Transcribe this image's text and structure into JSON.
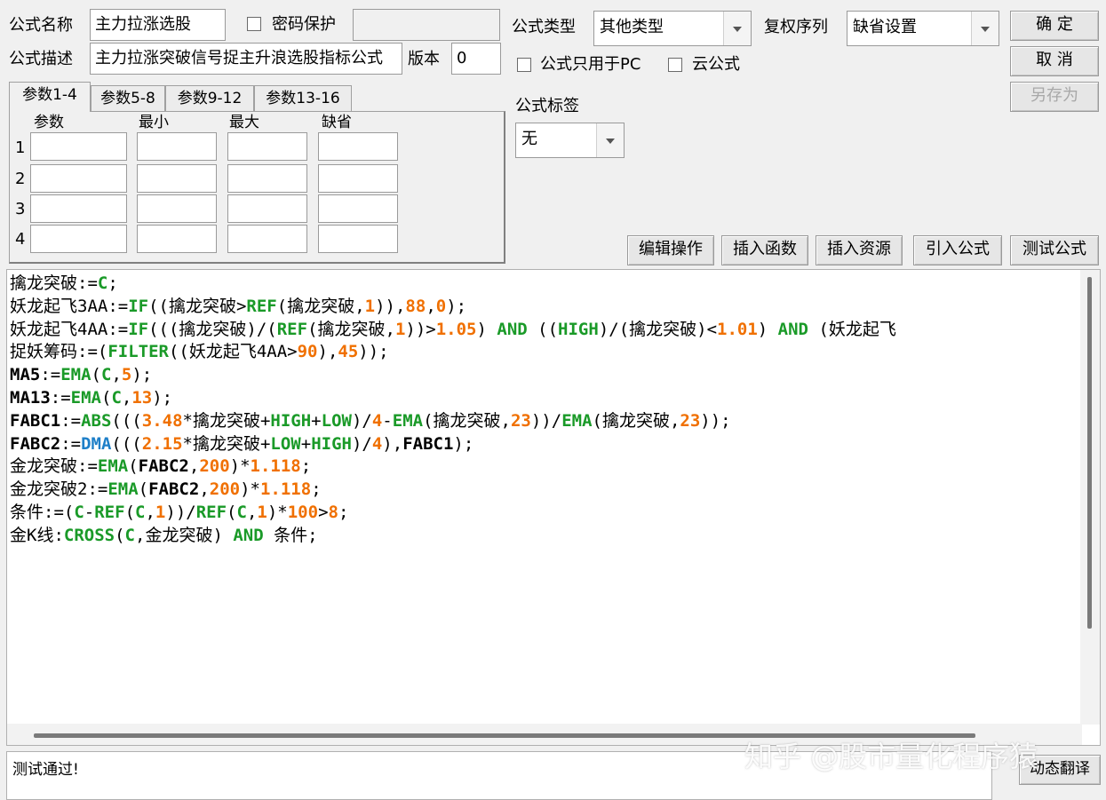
{
  "header": {
    "name_label": "公式名称",
    "name_value": "主力拉涨选股",
    "password_label": "密码保护",
    "password_value": "",
    "desc_label": "公式描述",
    "desc_value": "主力拉涨突破信号捉主升浪选股指标公式",
    "version_label": "版本",
    "version_value": "0",
    "type_label": "公式类型",
    "type_value": "其他类型",
    "fq_label": "复权序列",
    "fq_value": "缺省设置",
    "pc_only_label": "公式只用于PC",
    "cloud_label": "云公式",
    "tag_label": "公式标签",
    "tag_value": "无"
  },
  "buttons": {
    "ok": "确  定",
    "cancel": "取  消",
    "save_as": "另存为",
    "edit_ops": "编辑操作",
    "insert_func": "插入函数",
    "insert_res": "插入资源",
    "import_formula": "引入公式",
    "test_formula": "测试公式",
    "translate": "动态翻译"
  },
  "tabs": [
    {
      "label": "参数1-4"
    },
    {
      "label": "参数5-8"
    },
    {
      "label": "参数9-12"
    },
    {
      "label": "参数13-16"
    }
  ],
  "params": {
    "headers": [
      "参数",
      "最小",
      "最大",
      "缺省"
    ],
    "rows": [
      "1",
      "2",
      "3",
      "4"
    ]
  },
  "code_lines": [
    [
      [
        "t",
        "擒龙突破:="
      ],
      [
        "g",
        "C"
      ],
      [
        "t",
        ";"
      ]
    ],
    [
      [
        "t",
        "妖龙起飞3AA:="
      ],
      [
        "g",
        "IF"
      ],
      [
        "t",
        "((擒龙突破>"
      ],
      [
        "g",
        "REF"
      ],
      [
        "t",
        "(擒龙突破,"
      ],
      [
        "o",
        "1"
      ],
      [
        "t",
        ")),"
      ],
      [
        "o",
        "88"
      ],
      [
        "t",
        ","
      ],
      [
        "o",
        "0"
      ],
      [
        "t",
        ");"
      ]
    ],
    [
      [
        "t",
        "妖龙起飞4AA:="
      ],
      [
        "g",
        "IF"
      ],
      [
        "t",
        "(((擒龙突破)/("
      ],
      [
        "g",
        "REF"
      ],
      [
        "t",
        "(擒龙突破,"
      ],
      [
        "o",
        "1"
      ],
      [
        "t",
        "))>"
      ],
      [
        "o",
        "1.05"
      ],
      [
        "t",
        ") "
      ],
      [
        "g",
        "AND"
      ],
      [
        "t",
        " (("
      ],
      [
        "g",
        "HIGH"
      ],
      [
        "t",
        ")/(擒龙突破)<"
      ],
      [
        "o",
        "1.01"
      ],
      [
        "t",
        ") "
      ],
      [
        "g",
        "AND"
      ],
      [
        "t",
        " (妖龙起飞"
      ]
    ],
    [
      [
        "t",
        "捉妖筹码:=("
      ],
      [
        "g",
        "FILTER"
      ],
      [
        "t",
        "((妖龙起飞4AA>"
      ],
      [
        "o",
        "90"
      ],
      [
        "t",
        "),"
      ],
      [
        "o",
        "45"
      ],
      [
        "t",
        "));"
      ]
    ],
    [
      [
        "k",
        "MA5"
      ],
      [
        "t",
        ":="
      ],
      [
        "g",
        "EMA"
      ],
      [
        "t",
        "("
      ],
      [
        "g",
        "C"
      ],
      [
        "t",
        ","
      ],
      [
        "o",
        "5"
      ],
      [
        "t",
        ");"
      ]
    ],
    [
      [
        "k",
        "MA13"
      ],
      [
        "t",
        ":="
      ],
      [
        "g",
        "EMA"
      ],
      [
        "t",
        "("
      ],
      [
        "g",
        "C"
      ],
      [
        "t",
        ","
      ],
      [
        "o",
        "13"
      ],
      [
        "t",
        ");"
      ]
    ],
    [
      [
        "k",
        "FABC1"
      ],
      [
        "t",
        ":="
      ],
      [
        "g",
        "ABS"
      ],
      [
        "t",
        "((("
      ],
      [
        "o",
        "3.48"
      ],
      [
        "t",
        "*擒龙突破+"
      ],
      [
        "g",
        "HIGH"
      ],
      [
        "t",
        "+"
      ],
      [
        "g",
        "LOW"
      ],
      [
        "t",
        ")/"
      ],
      [
        "o",
        "4"
      ],
      [
        "t",
        "-"
      ],
      [
        "g",
        "EMA"
      ],
      [
        "t",
        "(擒龙突破,"
      ],
      [
        "o",
        "23"
      ],
      [
        "t",
        "))/"
      ],
      [
        "g",
        "EMA"
      ],
      [
        "t",
        "(擒龙突破,"
      ],
      [
        "o",
        "23"
      ],
      [
        "t",
        "));"
      ]
    ],
    [
      [
        "k",
        "FABC2"
      ],
      [
        "t",
        ":="
      ],
      [
        "b",
        "DMA"
      ],
      [
        "t",
        "((("
      ],
      [
        "o",
        "2.15"
      ],
      [
        "t",
        "*擒龙突破+"
      ],
      [
        "g",
        "LOW"
      ],
      [
        "t",
        "+"
      ],
      [
        "g",
        "HIGH"
      ],
      [
        "t",
        ")/"
      ],
      [
        "o",
        "4"
      ],
      [
        "t",
        "),"
      ],
      [
        "k",
        "FABC1"
      ],
      [
        "t",
        ");"
      ]
    ],
    [
      [
        "t",
        "金龙突破:="
      ],
      [
        "g",
        "EMA"
      ],
      [
        "t",
        "("
      ],
      [
        "k",
        "FABC2"
      ],
      [
        "t",
        ","
      ],
      [
        "o",
        "200"
      ],
      [
        "t",
        ")*"
      ],
      [
        "o",
        "1.118"
      ],
      [
        "t",
        ";"
      ]
    ],
    [
      [
        "t",
        "金龙突破2:="
      ],
      [
        "g",
        "EMA"
      ],
      [
        "t",
        "("
      ],
      [
        "k",
        "FABC2"
      ],
      [
        "t",
        ","
      ],
      [
        "o",
        "200"
      ],
      [
        "t",
        ")*"
      ],
      [
        "o",
        "1.118"
      ],
      [
        "t",
        ";"
      ]
    ],
    [
      [
        "t",
        "条件:=("
      ],
      [
        "g",
        "C"
      ],
      [
        "t",
        "-"
      ],
      [
        "g",
        "REF"
      ],
      [
        "t",
        "("
      ],
      [
        "g",
        "C"
      ],
      [
        "t",
        ","
      ],
      [
        "o",
        "1"
      ],
      [
        "t",
        "))/"
      ],
      [
        "g",
        "REF"
      ],
      [
        "t",
        "("
      ],
      [
        "g",
        "C"
      ],
      [
        "t",
        ","
      ],
      [
        "o",
        "1"
      ],
      [
        "t",
        ")*"
      ],
      [
        "o",
        "100"
      ],
      [
        "t",
        ">"
      ],
      [
        "o",
        "8"
      ],
      [
        "t",
        ";"
      ]
    ],
    [
      [
        "t",
        "金K线:"
      ],
      [
        "g",
        "CROSS"
      ],
      [
        "t",
        "("
      ],
      [
        "g",
        "C"
      ],
      [
        "t",
        ",金龙突破) "
      ],
      [
        "g",
        "AND"
      ],
      [
        "t",
        " 条件;"
      ]
    ]
  ],
  "status": {
    "message": "测试通过!"
  },
  "watermark": "知乎 @股市量化程序猿",
  "colors": {
    "function": "#1a9a28",
    "number": "#f07000",
    "dma": "#1e7fc8"
  }
}
